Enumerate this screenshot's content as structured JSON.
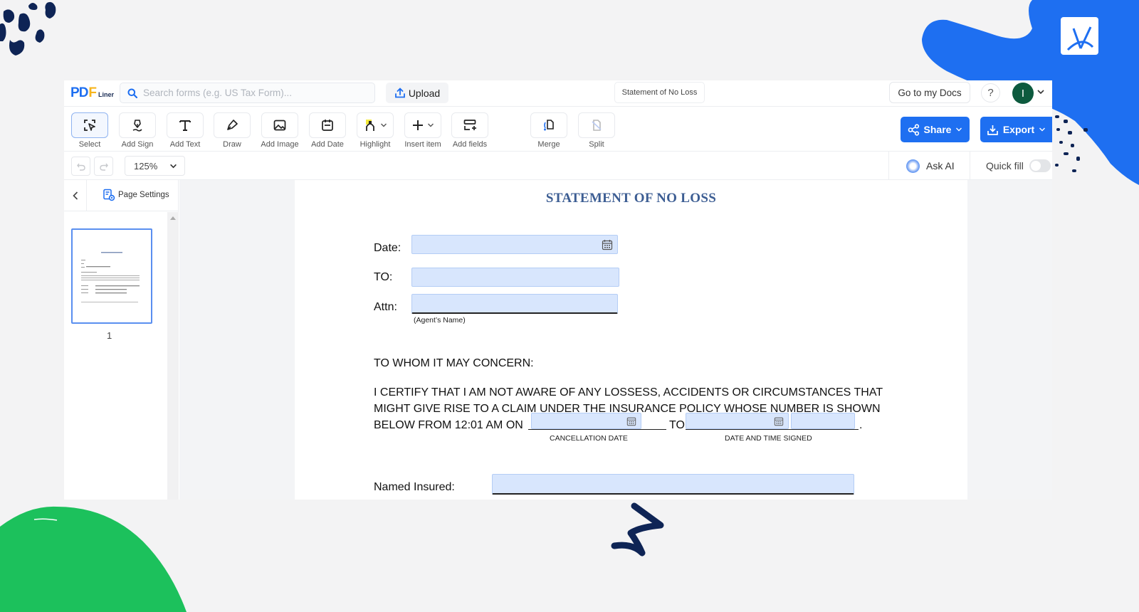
{
  "topbar": {
    "logo": {
      "p": "P",
      "d": "D",
      "f": "F",
      "liner": "Liner"
    },
    "search_placeholder": "Search forms (e.g. US Tax Form)...",
    "search_value": "",
    "upload_label": "Upload",
    "document_name": "Statement of No Loss",
    "go_to_docs_label": "Go to my Docs",
    "help_label": "?",
    "avatar_initial": "I"
  },
  "tools": [
    {
      "id": "select",
      "label": "Select",
      "icon": "select-cursor-icon",
      "active": true
    },
    {
      "id": "add-sign",
      "label": "Add Sign",
      "icon": "signature-pen-icon"
    },
    {
      "id": "add-text",
      "label": "Add Text",
      "icon": "text-T-icon"
    },
    {
      "id": "draw",
      "label": "Draw",
      "icon": "pen-nib-icon"
    },
    {
      "id": "add-image",
      "label": "Add Image",
      "icon": "image-icon"
    },
    {
      "id": "add-date",
      "label": "Add Date",
      "icon": "calendar-icon"
    },
    {
      "id": "highlight",
      "label": "Highlight",
      "icon": "highlighter-icon",
      "dropdown": true
    },
    {
      "id": "insert-item",
      "label": "Insert item",
      "icon": "plus-icon",
      "dropdown": true
    },
    {
      "id": "add-fields",
      "label": "Add fields",
      "icon": "add-fields-icon"
    },
    {
      "id": "merge",
      "label": "Merge",
      "icon": "merge-icon"
    },
    {
      "id": "split",
      "label": "Split",
      "icon": "split-icon",
      "disabled": true
    }
  ],
  "actions": {
    "share_label": "Share",
    "export_label": "Export"
  },
  "secondary": {
    "zoom_level": "125%",
    "ask_ai_label": "Ask AI",
    "quick_fill_label": "Quick fill",
    "quick_fill_on": false
  },
  "sidebar": {
    "page_settings_label": "Page Settings",
    "pages": [
      {
        "number": "1",
        "selected": true
      }
    ]
  },
  "document": {
    "title": "STATEMENT OF NO LOSS",
    "fields": {
      "date_label": "Date:",
      "date_value": "",
      "to_label": "TO:",
      "to_value": "",
      "attn_label": "Attn:",
      "attn_value": "",
      "attn_caption": "(Agent’s Name)",
      "named_insured_label": "Named Insured:",
      "named_insured_value": ""
    },
    "salutation": "TO WHOM IT MAY CONCERN:",
    "paragraph": [
      "I CERTIFY THAT I AM NOT AWARE OF ANY LOSSESS, ACCIDENTS OR CIRCUMSTANCES THAT",
      "MIGHT GIVE RISE TO A CLAIM UNDER THE INSURANCE POLICY WHOSE NUMBER IS SHOWN",
      "BELOW FROM 12:01 AM ON"
    ],
    "to_word": "TO",
    "period": ".",
    "cancellation_date_caption": "CANCELLATION DATE",
    "date_time_signed_caption": "DATE AND TIME SIGNED",
    "cancellation_date_value": "",
    "signed_date_value": "",
    "signed_time_value": ""
  },
  "colors": {
    "brand_blue": "#1e6ff1",
    "logo_yellow": "#f7b51d",
    "field_fill": "#d8e6fd",
    "title_blue": "#3c5d93",
    "avatar_green": "#0d5a3e",
    "deco_navy": "#0e2455",
    "deco_green": "#1cc15c"
  }
}
